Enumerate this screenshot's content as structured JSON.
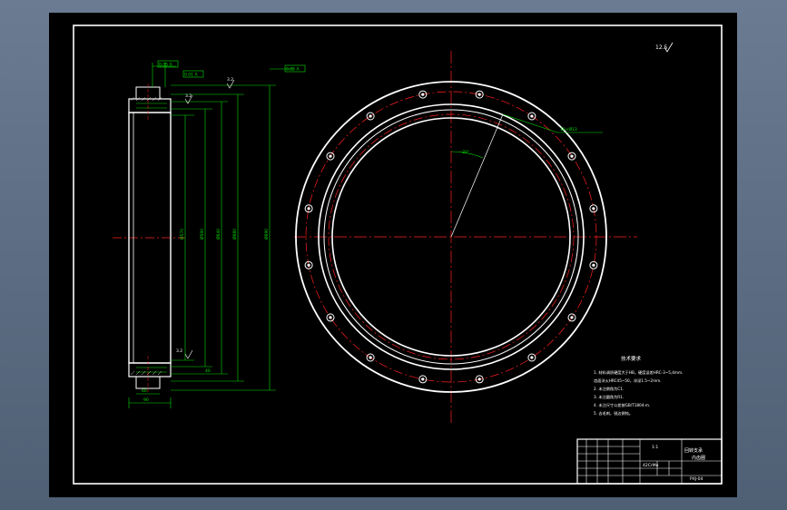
{
  "drawing": {
    "surface_symbol": "12.5",
    "roughness_a": "3.2",
    "roughness_b": "3.2",
    "roughness_c": "3.2",
    "tolerance_a": "0.05 A",
    "tolerance_b": "0.01 A",
    "tolerance_c": "0.05 A",
    "dim_width": "40",
    "dim_tooth": "60",
    "dim_bottom": "90",
    "dim_d1": "Ø570",
    "dim_d2": "Ø590",
    "dim_d3": "Ø640",
    "dim_d4": "Ø680",
    "dim_d5": "Ø690",
    "angle": "30°",
    "hole_callout": "16×Ø13",
    "notes_title": "技术要求",
    "notes": [
      "1. 材料调质硬度大于HB，硬度误差HRC-3~5,4mm.",
      "   齿面淬火HRC45~50，淬深1.5~2mm.",
      "2. 未注倒角为C1.",
      "3. 未注圆角为R1.",
      "4. 未注尺寸公差按GB/T1804-m.",
      "5. 去毛刺，锐边倒钝。"
    ],
    "titleblock": {
      "part_name": "内齿圈",
      "assembly": "回转支承",
      "scale": "1:1",
      "drawing_no": "PXJ-04",
      "material": "42CrMo"
    }
  },
  "colors": {
    "background": "#000000",
    "outline": "#ffffff",
    "center_line": "#ff2020",
    "dimension": "#00e000",
    "frame": "#ffffff"
  }
}
